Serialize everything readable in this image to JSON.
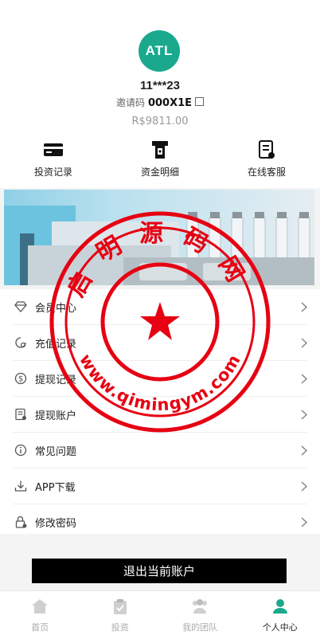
{
  "profile": {
    "avatar_text": "ATL",
    "username": "11***23",
    "invite_label": "邀请码",
    "invite_code": "000X1E",
    "balance": "R$9811.00"
  },
  "shortcuts": [
    {
      "label": "投资记录",
      "icon": "card-icon"
    },
    {
      "label": "资金明细",
      "icon": "atm-icon"
    },
    {
      "label": "在线客服",
      "icon": "document-icon"
    }
  ],
  "menu": [
    {
      "label": "会员中心",
      "icon": "diamond-icon"
    },
    {
      "label": "充值记录",
      "icon": "recharge-icon"
    },
    {
      "label": "提现记录",
      "icon": "dollar-icon"
    },
    {
      "label": "提现账户",
      "icon": "account-icon"
    },
    {
      "label": "常见问题",
      "icon": "info-icon"
    },
    {
      "label": "APP下载",
      "icon": "download-icon"
    },
    {
      "label": "修改密码",
      "icon": "lock-icon"
    }
  ],
  "logout_label": "退出当前账户",
  "tabs": [
    {
      "label": "首页",
      "icon": "home-icon",
      "active": false
    },
    {
      "label": "投资",
      "icon": "clipboard-icon",
      "active": false
    },
    {
      "label": "我的团队",
      "icon": "team-icon",
      "active": false
    },
    {
      "label": "个人中心",
      "icon": "person-icon",
      "active": true
    }
  ],
  "watermark": {
    "text_top": "启明源码网",
    "text_bottom": "www.qimingym.com"
  },
  "colors": {
    "accent": "#1aa98d",
    "stamp": "#e60012"
  }
}
